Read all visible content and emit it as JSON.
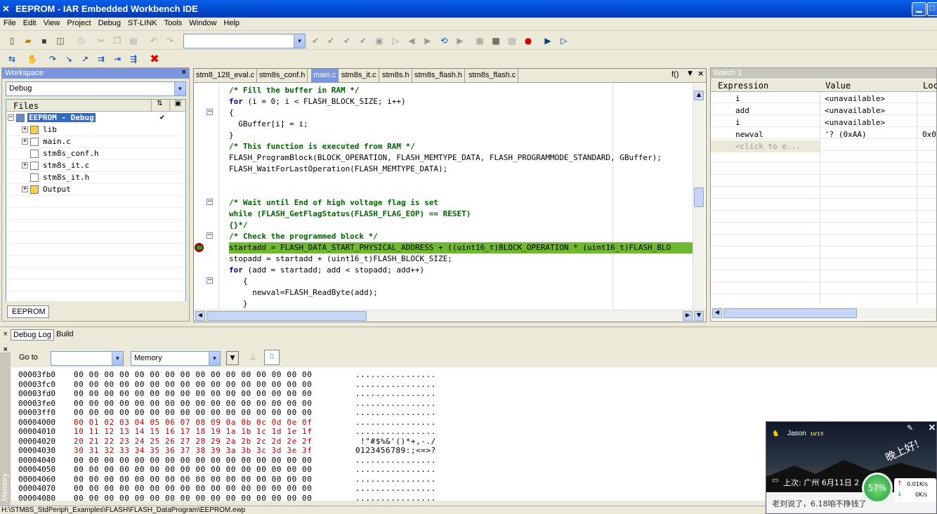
{
  "window": {
    "title": "EEPROM - IAR Embedded Workbench IDE"
  },
  "menu": [
    "File",
    "Edit",
    "View",
    "Project",
    "Debug",
    "ST-LINK",
    "Tools",
    "Window",
    "Help"
  ],
  "workspace": {
    "title": "Workspace",
    "config": "Debug",
    "files_header": "Files",
    "tree": [
      {
        "label": "EEPROM - Debug",
        "level": 0,
        "expander": "-",
        "icon": "project",
        "selected": true
      },
      {
        "label": "lib",
        "level": 1,
        "expander": "+",
        "icon": "folder"
      },
      {
        "label": "main.c",
        "level": 1,
        "expander": "+",
        "icon": "file"
      },
      {
        "label": "stm8s_conf.h",
        "level": 1,
        "expander": "",
        "icon": "file"
      },
      {
        "label": "stm8s_it.c",
        "level": 1,
        "expander": "+",
        "icon": "file"
      },
      {
        "label": "stm8s_it.h",
        "level": 1,
        "expander": "",
        "icon": "file"
      },
      {
        "label": "Output",
        "level": 1,
        "expander": "+",
        "icon": "folder"
      }
    ],
    "bottom_tab": "EEPROM"
  },
  "editor": {
    "tabs": [
      "stm8_128_eval.c",
      "stm8s_conf.h",
      "main.c",
      "stm8s_it.c",
      "stm8s.h",
      "stm8s_flash.h",
      "stm8s_flash.c"
    ],
    "active_tab": 2,
    "func_button": "f()",
    "lines": [
      [
        {
          "t": "/* Fill the buffer in RAM */",
          "c": "cm"
        }
      ],
      [
        {
          "t": "for",
          "c": "kw"
        },
        {
          "t": " (i = 0; i < FLASH_BLOCK_SIZE; i++)",
          "c": ""
        }
      ],
      [
        {
          "t": "{",
          "c": ""
        }
      ],
      [
        {
          "t": "  GBuffer[i] = i;",
          "c": ""
        }
      ],
      [
        {
          "t": "}",
          "c": ""
        }
      ],
      [
        {
          "t": "/* This function is executed from RAM */",
          "c": "cm"
        }
      ],
      [
        {
          "t": "FLASH_ProgramBlock(BLOCK_OPERATION, FLASH_MEMTYPE_DATA, FLASH_PROGRAMMODE_STANDARD, GBuffer);",
          "c": ""
        }
      ],
      [
        {
          "t": "FLASH_WaitForLastOperation(FLASH_MEMTYPE_DATA);",
          "c": ""
        }
      ],
      [],
      [],
      [
        {
          "t": "/* Wait until End of high voltage flag is set",
          "c": "cm"
        }
      ],
      [
        {
          "t": "while (FLASH_GetFlagStatus(FLASH_FLAG_EOP) == RESET)",
          "c": "cm"
        }
      ],
      [
        {
          "t": "{}*/",
          "c": "cm"
        }
      ],
      [
        {
          "t": "/* Check the programmed block */",
          "c": "cm"
        }
      ],
      [
        {
          "t": "startadd = FLASH_DATA_START_PHYSICAL_ADDRESS + ((uint16_t)BLOCK_OPERATION * (uint16_t)FLASH_BLO",
          "c": ""
        }
      ],
      [
        {
          "t": "stopadd = startadd + (uint16_t)FLASH_BLOCK_SIZE;",
          "c": ""
        }
      ],
      [
        {
          "t": "for",
          "c": "kw"
        },
        {
          "t": " (add = startadd; add < stopadd; add++)",
          "c": ""
        }
      ],
      [
        {
          "t": "   {",
          "c": ""
        }
      ],
      [
        {
          "t": "     newval=FLASH_ReadByte(add);",
          "c": ""
        }
      ],
      [
        {
          "t": "   }",
          "c": ""
        }
      ]
    ],
    "current_line": 14
  },
  "watch": {
    "title": "Watch 1",
    "columns": [
      "Expression",
      "Value",
      "Loc"
    ],
    "rows": [
      {
        "expr": "i",
        "value": "<unavailable>",
        "loc": ""
      },
      {
        "expr": "add",
        "value": "<unavailable>",
        "loc": ""
      },
      {
        "expr": "i",
        "value": "<unavailable>",
        "loc": ""
      },
      {
        "expr": "newval",
        "value": "'? (0xAA)",
        "loc": "0x0"
      },
      {
        "expr": "<click to e...",
        "value": "",
        "loc": ""
      }
    ]
  },
  "bottom_tabs": [
    "Debug Log",
    "Build"
  ],
  "memory": {
    "goto_label": "Go to",
    "goto_value": "",
    "zone": "Memory",
    "side_label": "Memory",
    "rows": [
      {
        "addr": "00003fb0",
        "bytes": "00 00 00 00 00 00 00 00 00 00 00 00 00 00 00 00",
        "ascii": "................",
        "red": false
      },
      {
        "addr": "00003fc0",
        "bytes": "00 00 00 00 00 00 00 00 00 00 00 00 00 00 00 00",
        "ascii": "................",
        "red": false
      },
      {
        "addr": "00003fd0",
        "bytes": "00 00 00 00 00 00 00 00 00 00 00 00 00 00 00 00",
        "ascii": "................",
        "red": false
      },
      {
        "addr": "00003fe0",
        "bytes": "00 00 00 00 00 00 00 00 00 00 00 00 00 00 00 00",
        "ascii": "................",
        "red": false
      },
      {
        "addr": "00003ff0",
        "bytes": "00 00 00 00 00 00 00 00 00 00 00 00 00 00 00 00",
        "ascii": "................",
        "red": false
      },
      {
        "addr": "00004000",
        "bytes": "00 01 02 03 04 05 06 07 08 09 0a 0b 0c 0d 0e 0f",
        "ascii": "................",
        "red": true
      },
      {
        "addr": "00004010",
        "bytes": "10 11 12 13 14 15 16 17 18 19 1a 1b 1c 1d 1e 1f",
        "ascii": "................",
        "red": true
      },
      {
        "addr": "00004020",
        "bytes": "20 21 22 23 24 25 26 27 28 29 2a 2b 2c 2d 2e 2f",
        "ascii": " !\"#$%&'()*+,-./",
        "red": true
      },
      {
        "addr": "00004030",
        "bytes": "30 31 32 33 34 35 36 37 38 39 3a 3b 3c 3d 3e 3f",
        "ascii": "0123456789:;<=>?",
        "red": true
      },
      {
        "addr": "00004040",
        "bytes": "00 00 00 00 00 00 00 00 00 00 00 00 00 00 00 00",
        "ascii": "................",
        "red": false
      },
      {
        "addr": "00004050",
        "bytes": "00 00 00 00 00 00 00 00 00 00 00 00 00 00 00 00",
        "ascii": "................",
        "red": false
      },
      {
        "addr": "00004060",
        "bytes": "00 00 00 00 00 00 00 00 00 00 00 00 00 00 00 00",
        "ascii": "................",
        "red": false
      },
      {
        "addr": "00004070",
        "bytes": "00 00 00 00 00 00 00 00 00 00 00 00 00 00 00 00",
        "ascii": "................",
        "red": false
      },
      {
        "addr": "00004080",
        "bytes": "00 00 00 00 00 00 00 00 00 00 00 00 00 00 00 00",
        "ascii": "................",
        "red": false
      }
    ]
  },
  "statusbar": {
    "path": "H:\\STM8S_StdPeriph_Examples\\FLASH\\FLASH_DataProgram\\EEPROM.ewp"
  },
  "qq_popup": {
    "name": "Jason",
    "level": "LV15",
    "greeting": "晚上好!",
    "last_login": "上次: 广州  6月11日 2",
    "percent": "57%",
    "up_speed": "0.01K/s",
    "down_speed": "0K/s",
    "news": "老刘说了，6.18咱不挣钱了"
  }
}
